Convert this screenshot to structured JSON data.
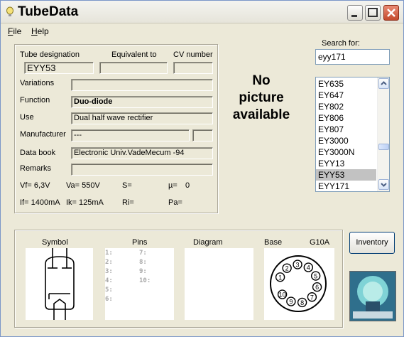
{
  "window": {
    "title": "TubeData"
  },
  "menu": {
    "file": "File",
    "file_acc": "F",
    "file_rest": "ile",
    "help": "Help",
    "help_acc": "H",
    "help_rest": "elp"
  },
  "headers": {
    "designation": "Tube designation",
    "equivalent": "Equivalent to",
    "cv": "CV number"
  },
  "fields": {
    "designation": "EYY53",
    "equivalent": "",
    "cv": "",
    "variations_label": "Variations",
    "variations": "",
    "function_label": "Function",
    "function": "Duo-diode",
    "use_label": "Use",
    "use": "Dual half wave rectifier",
    "manufacturer_label": "Manufacturer",
    "manufacturer": "---",
    "manufacturer_code": "",
    "databook_label": "Data book",
    "databook": "Electronic Univ.VadeMecum -94",
    "remarks_label": "Remarks",
    "remarks": ""
  },
  "params": {
    "vf": "Vf= 6,3V",
    "va": "Va= 550V",
    "s": "S=",
    "mu": "µ=",
    "mu_val": "0",
    "if": "If= 1400mA",
    "ik": "Ik= 125mA",
    "ri": "Ri=",
    "pa": "Pa="
  },
  "no_picture": {
    "line1": "No",
    "line2": "picture",
    "line3": "available"
  },
  "search": {
    "label": "Search for:",
    "value": "eyy171"
  },
  "tube_list": {
    "items": [
      "EY635",
      "EY647",
      "EY802",
      "EY806",
      "EY807",
      "EY3000",
      "EY3000N",
      "EYY13",
      "EYY53",
      "EYY171"
    ],
    "selected": "EYY53"
  },
  "bottom": {
    "symbol": "Symbol",
    "pins": "Pins",
    "diagram": "Diagram",
    "base": "Base",
    "base_type": "G10A",
    "pins_left": [
      "1:",
      "2:",
      "3:",
      "4:",
      "5:",
      "6:"
    ],
    "pins_right": [
      "7:",
      "8:",
      "9:",
      "10:"
    ],
    "base_numbers": [
      "1",
      "2",
      "3",
      "4",
      "5",
      "6",
      "7",
      "8",
      "9",
      "10"
    ]
  },
  "inventory": {
    "label": "Inventory"
  },
  "colors": {
    "titlebar": "#ece9d8",
    "close_button": "#c44a2c",
    "selection": "#c2c2c2"
  }
}
